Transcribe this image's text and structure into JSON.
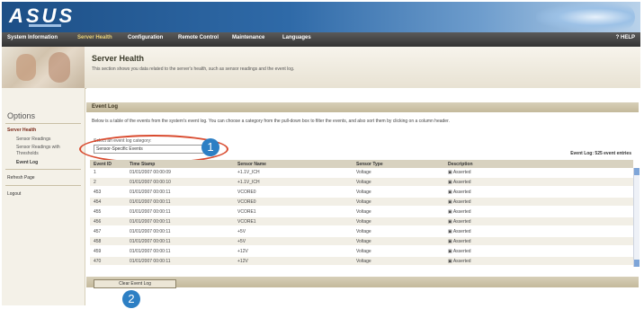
{
  "app": {
    "logo_text": "ASUS"
  },
  "menu": {
    "items": [
      "System Information",
      "Server Health",
      "Configuration",
      "Remote Control",
      "Maintenance",
      "Languages"
    ],
    "active_index": 1,
    "help_label": "? HELP"
  },
  "page": {
    "title": "Server Health",
    "description": "This section shows you data related to the server's health, such as sensor readings and the event log."
  },
  "sidebar": {
    "title": "Options",
    "items": [
      {
        "label": "Server Health",
        "level": "group"
      },
      {
        "label": "Sensor Readings",
        "level": "sub"
      },
      {
        "label": "Sensor Readings with",
        "level": "sub"
      },
      {
        "label": "Thresholds",
        "level": "sub"
      },
      {
        "label": "Event Log",
        "level": "subsel"
      },
      {
        "label": "Refresh Page",
        "level": "group"
      },
      {
        "label": "Logout",
        "level": "group"
      }
    ]
  },
  "event_log": {
    "title": "Event Log",
    "description": "Below is a table of the events from the system's event log. You can choose a category from the pull-down box to filter the events, and also sort them by clicking on a column header.",
    "select_label": "Select an event log category:",
    "select_value": "Sensor-Specific Events",
    "entries_count": "Event Log: 525 event entries",
    "columns": [
      "Event ID",
      "Time Stamp",
      "Sensor Name",
      "Sensor Type",
      "Description"
    ],
    "rows": [
      [
        "1",
        "01/01/2007 00:00:09",
        "+1.1V_ICH",
        "Voltage",
        "Asserted"
      ],
      [
        "2",
        "01/01/2007 00:00:10",
        "+1.1V_ICH",
        "Voltage",
        "Asserted"
      ],
      [
        "453",
        "01/01/2007 00:00:11",
        "VCORE0",
        "Voltage",
        "Asserted"
      ],
      [
        "454",
        "01/01/2007 00:00:11",
        "VCORE0",
        "Voltage",
        "Asserted"
      ],
      [
        "455",
        "01/01/2007 00:00:11",
        "VCORE1",
        "Voltage",
        "Asserted"
      ],
      [
        "456",
        "01/01/2007 00:00:11",
        "VCORE1",
        "Voltage",
        "Asserted"
      ],
      [
        "457",
        "01/01/2007 00:00:11",
        "+5V",
        "Voltage",
        "Asserted"
      ],
      [
        "458",
        "01/01/2007 00:00:11",
        "+5V",
        "Voltage",
        "Asserted"
      ],
      [
        "459",
        "01/01/2007 00:00:11",
        "+12V",
        "Voltage",
        "Asserted"
      ],
      [
        "470",
        "01/01/2007 00:00:11",
        "+12V",
        "Voltage",
        "Asserted"
      ]
    ],
    "clear_button": "Clear Event Log"
  },
  "callouts": [
    "1",
    "2"
  ],
  "colors": {
    "callout": "#2d7fc4",
    "highlight_oval": "#d94b2f",
    "header": "#1d4f86"
  }
}
